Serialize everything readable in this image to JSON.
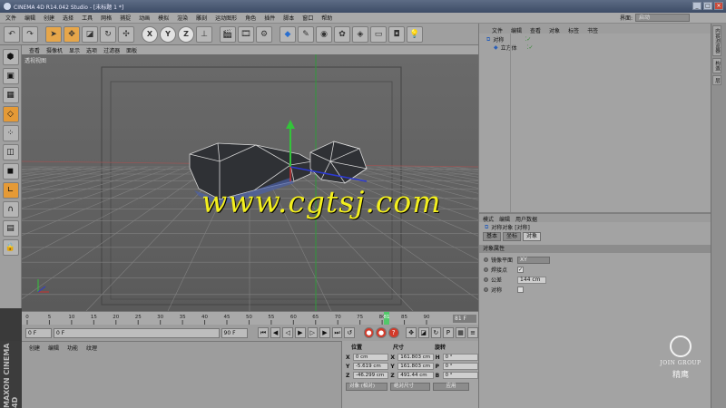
{
  "window": {
    "title": "CINEMA 4D R14.042 Studio - [未标题 1 *]",
    "min": "_",
    "max": "□",
    "close": "×"
  },
  "menubar": {
    "items": [
      "文件",
      "编辑",
      "创建",
      "选择",
      "工具",
      "网格",
      "捕捉",
      "动画",
      "模拟",
      "渲染",
      "雕刻",
      "运动图形",
      "角色",
      "插件",
      "脚本",
      "窗口",
      "帮助"
    ],
    "layout_label": "界面:",
    "layout_value": "启动"
  },
  "toolbar": {
    "icons": [
      "undo-icon",
      "redo-icon",
      "select-icon",
      "move-icon",
      "scale-icon",
      "rotate-icon",
      "recent-tool-icon",
      "x-axis-icon",
      "y-axis-icon",
      "z-axis-icon",
      "coord-system-icon",
      "render-view-icon",
      "render-picture-icon",
      "render-settings-icon",
      "cube-icon",
      "spline-icon",
      "nurbs-icon",
      "array-icon",
      "deformer-icon",
      "floor-icon",
      "camera-icon",
      "light-icon"
    ],
    "x_label": "X",
    "y_label": "Y",
    "z_label": "Z"
  },
  "left_tools": [
    "make-editable-icon",
    "model-mode-icon",
    "texture-mode-icon",
    "workplane-icon",
    "points-icon",
    "edges-icon",
    "polygons-icon",
    "axis-icon",
    "magnet-icon",
    "snap-icon",
    "lock-icon"
  ],
  "viewport": {
    "menu": [
      "查看",
      "摄像机",
      "显示",
      "选项",
      "过滤器",
      "面板"
    ],
    "label": "透视视图"
  },
  "timeline": {
    "ticks": [
      "0",
      "5",
      "10",
      "15",
      "20",
      "25",
      "30",
      "35",
      "40",
      "45",
      "50",
      "55",
      "60",
      "65",
      "70",
      "75",
      "80",
      "85",
      "90"
    ],
    "current_frame_marker": "81",
    "frame_readout": "81 F",
    "playhead_fraction": 0.9
  },
  "transport": {
    "start": "0 F",
    "current": "0 F",
    "end": "90 F"
  },
  "material": {
    "menu": [
      "创建",
      "编辑",
      "功能",
      "纹理"
    ]
  },
  "coords": {
    "headers": [
      "位置",
      "尺寸",
      "旋转"
    ],
    "rows": [
      {
        "axis": "X",
        "pos": "0 cm",
        "size": "161.803 cm",
        "rot_label": "H",
        "rot": "0 °"
      },
      {
        "axis": "Y",
        "pos": "-5.619 cm",
        "size": "161.803 cm",
        "rot_label": "P",
        "rot": "0 °"
      },
      {
        "axis": "Z",
        "pos": "-46.299 cm",
        "size": "491.44 cm",
        "rot_label": "B",
        "rot": "0 °"
      }
    ],
    "mode": "对象 (相对)",
    "size_mode": "绝对尺寸",
    "apply": "应用"
  },
  "object_manager": {
    "menu": [
      "文件",
      "编辑",
      "查看",
      "对象",
      "标签",
      "书签"
    ],
    "objects": [
      "对称",
      "立方体"
    ]
  },
  "attribute_manager": {
    "menu": [
      "模式",
      "编辑",
      "用户数据"
    ],
    "object_title": "对称对象 [对称]",
    "tabs": [
      "基本",
      "坐标",
      "对象"
    ],
    "section": "对象属性",
    "props": [
      {
        "label": "镜像平面",
        "value": "XY",
        "type": "select"
      },
      {
        "label": "焊接点",
        "value": "✓",
        "type": "check"
      },
      {
        "label": "公差",
        "value": "144 cm",
        "type": "field"
      },
      {
        "label": "对称",
        "value": "",
        "type": "check"
      }
    ]
  },
  "side_tabs": [
    "内容浏览器",
    "构造",
    "层"
  ],
  "watermark": "www.cgtsj.com",
  "join_logo": {
    "en": "JOIN GROUP",
    "cn": "精鹰"
  },
  "maxon": "MAXON CINEMA 4D",
  "colors": {
    "accent": "#e59a36",
    "watermark": "#f3ef1e"
  }
}
